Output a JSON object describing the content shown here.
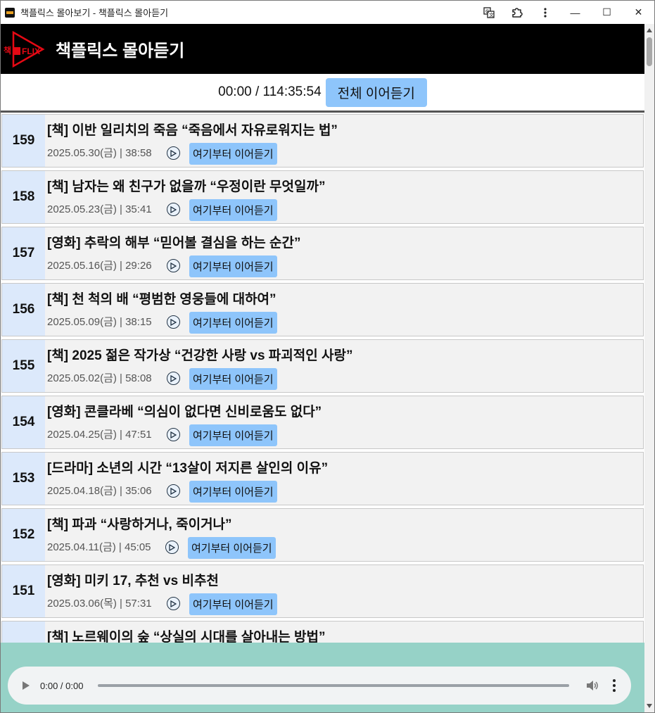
{
  "window": {
    "title": "책플릭스 몰아보기 - 책플릭스 몰아듣기",
    "minimize_glyph": "—",
    "maximize_glyph": "☐",
    "close_glyph": "✕"
  },
  "header": {
    "logo_text_left": "책",
    "logo_text_right": "FLIX",
    "title": "책플릭스 몰아듣기"
  },
  "player_top": {
    "time": "00:00 / 114:35:54",
    "resume_all_label": "전체 이어듣기"
  },
  "episodes": [
    {
      "num": "159",
      "title": "[책] 이반 일리치의 죽음 “죽음에서 자유로워지는 법”",
      "meta": "2025.05.30(금) | 38:58",
      "resume_label": "여기부터 이어듣기"
    },
    {
      "num": "158",
      "title": "[책] 남자는 왜 친구가 없을까 “우정이란 무엇일까”",
      "meta": "2025.05.23(금) | 35:41",
      "resume_label": "여기부터 이어듣기"
    },
    {
      "num": "157",
      "title": "[영화] 추락의 해부 “믿어볼 결심을 하는 순간”",
      "meta": "2025.05.16(금) | 29:26",
      "resume_label": "여기부터 이어듣기"
    },
    {
      "num": "156",
      "title": "[책] 천 척의 배 “평범한 영웅들에 대하여”",
      "meta": "2025.05.09(금) | 38:15",
      "resume_label": "여기부터 이어듣기"
    },
    {
      "num": "155",
      "title": "[책] 2025 젊은 작가상 “건강한 사랑 vs 파괴적인 사랑”",
      "meta": "2025.05.02(금) | 58:08",
      "resume_label": "여기부터 이어듣기"
    },
    {
      "num": "154",
      "title": "[영화] 콘클라베 “의심이 없다면 신비로움도 없다”",
      "meta": "2025.04.25(금) | 47:51",
      "resume_label": "여기부터 이어듣기"
    },
    {
      "num": "153",
      "title": "[드라마] 소년의 시간 “13살이 저지른 살인의 이유”",
      "meta": "2025.04.18(금) | 35:06",
      "resume_label": "여기부터 이어듣기"
    },
    {
      "num": "152",
      "title": "[책] 파과 “사랑하거나, 죽이거나”",
      "meta": "2025.04.11(금) | 45:05",
      "resume_label": "여기부터 이어듣기"
    },
    {
      "num": "151",
      "title": "[영화] 미키 17, 추천 vs 비추천",
      "meta": "2025.03.06(목) | 57:31",
      "resume_label": "여기부터 이어듣기"
    }
  ],
  "partial_episode": {
    "title": "[책] 노르웨이의 숲 “상실의 시대를 살아내는 방법”"
  },
  "audio": {
    "time": "0:00 / 0:00"
  },
  "colors": {
    "accent_button": "#8ec5fb",
    "number_cell": "#dce9fb",
    "footer": "#96d2c7",
    "logo_red": "#e50914"
  }
}
